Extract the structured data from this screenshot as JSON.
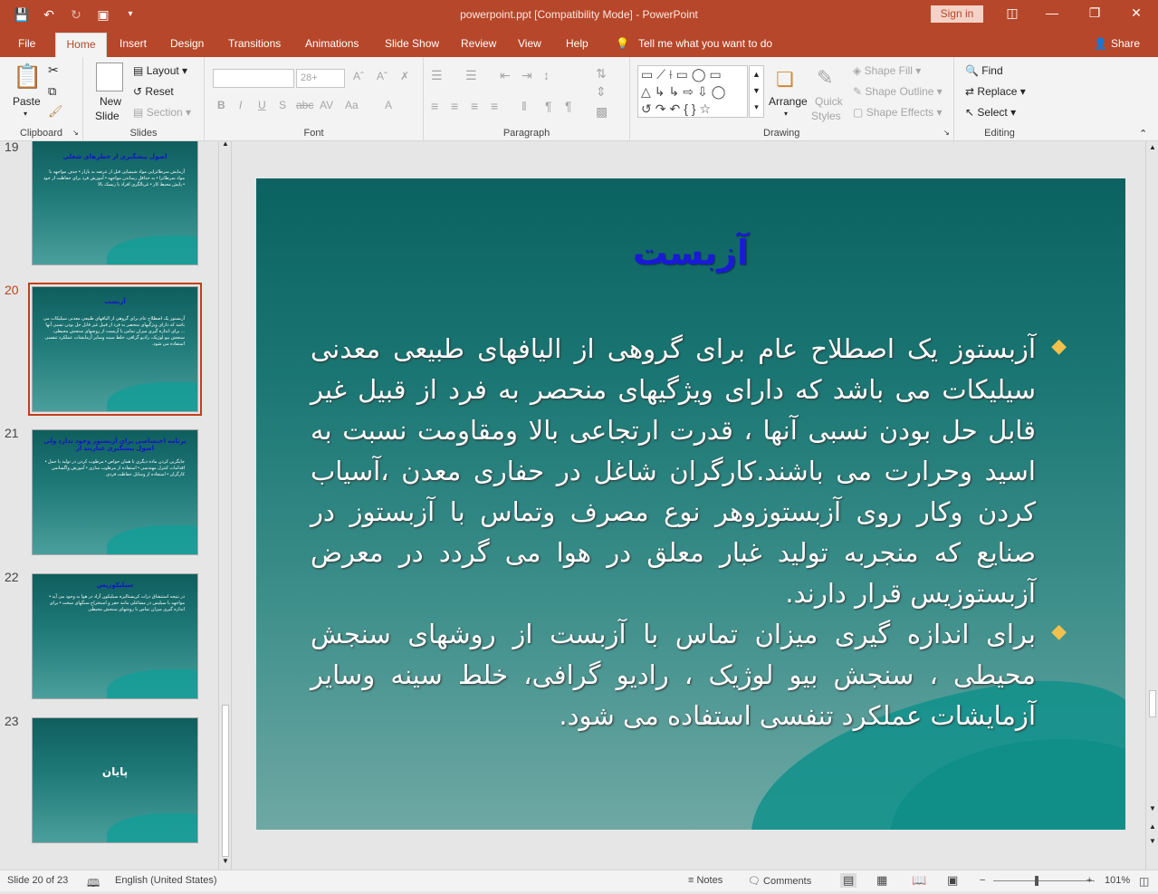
{
  "titlebar": {
    "title": "powerpoint.ppt [Compatibility Mode]  -  PowerPoint",
    "signin": "Sign in",
    "qat": [
      "save-icon",
      "undo-icon",
      "redo-icon",
      "present-icon",
      "customize-icon"
    ]
  },
  "tabs": [
    "File",
    "Home",
    "Insert",
    "Design",
    "Transitions",
    "Animations",
    "Slide Show",
    "Review",
    "View",
    "Help"
  ],
  "active_tab": "Home",
  "tell_me": "Tell me what you want to do",
  "share": "Share",
  "ribbon": {
    "clipboard": {
      "label": "Clipboard",
      "paste": "Paste"
    },
    "slides": {
      "label": "Slides",
      "new_slide_1": "New",
      "new_slide_2": "Slide",
      "layout": "Layout",
      "reset": "Reset",
      "section": "Section"
    },
    "font": {
      "label": "Font",
      "size": "28+"
    },
    "paragraph": {
      "label": "Paragraph"
    },
    "drawing": {
      "label": "Drawing",
      "arrange": "Arrange",
      "quick_styles_1": "Quick",
      "quick_styles_2": "Styles",
      "shape_fill": "Shape Fill",
      "shape_outline": "Shape Outline",
      "shape_effects": "Shape Effects"
    },
    "editing": {
      "label": "Editing",
      "find": "Find",
      "replace": "Replace",
      "select": "Select"
    }
  },
  "thumbnails": [
    {
      "num": "19",
      "title": "اصول پیشگیری از خطرهای شغلی",
      "body": "آزمایش سرطانزایی مواد شیمیایی قبل از عرضه به بازار • حذف مواجهه با مواد سرطانزا • به حداقل رساندن مواجهه • آموزش فرد برای حفاظت از خود • پایش محیط کار • غربالگری افراد با ریسک بالا"
    },
    {
      "num": "20",
      "title": "آزبست",
      "body": "آزبستوز یک اصطلاح عام برای گروهی از الیافهای طبیعی معدنی سیلیکات می باشد که دارای ویژگیهای منحصر به فرد از قبیل غیر قابل حل بودن نسبی آنها ... برای اندازه گیری میزان تماس با آزبست از روشهای سنجش محیطی، سنجش بیو لوژیک، رادیو گرافی، خلط سینه وسایر آزمایشات عملکرد تنفسی استفاده می شود."
    },
    {
      "num": "21",
      "title": "برنامه اختصاصی برای آزبستوز وجود ندارد ولی اصول پیشگیری عبارتند از",
      "body": "جایگزین کردن ماده دیگری با همان خواص • مرطوب کردن در تولید یا حمل • اقدامات کنترل مهندسی • استفاده از مرطوب سازی • آموزش واگسانس کارگران • استفاده از وسایل حفاظت فردی"
    },
    {
      "num": "22",
      "title": "سیلیکوزیس",
      "body": "در نتیجه استنشاق ذرات کریستالیزه سیلیکون آزاد در هوا به وجود می آید • مواجهه با سیلیس در مشاغلی مانند حفر و استخراج سنگهای سخت • برای اندازه گیری میزان تماس با روشهای سنجش محیطی"
    },
    {
      "num": "23",
      "title": "پایان",
      "body": ""
    }
  ],
  "slide": {
    "title": "آزبست",
    "bullets": [
      "آزبستوز یک اصطلاح عام برای گروهی از الیافهای طبیعی معدنی سیلیکات می باشد که دارای ویژگیهای منحصر به فرد از قبیل غیر قابل حل بودن نسبی آنها ، قدرت ارتجاعی بالا ومقاومت نسبت به اسید وحرارت می باشند.کارگران شاغل در حفاری معدن ،آسیاب کردن وکار روی آزبستوزوهر نوع مصرف وتماس با آزبستوز در صنایع که منجربه تولید غبار معلق در هوا می گردد در معرض آزبستوزیس قرار دارند.",
      "برای اندازه گیری میزان تماس با آزبست از روشهای سنجش محیطی ، سنجش بیو لوژیک ، رادیو گرافی، خلط سینه وسایر آزمایشات عملکرد تنفسی استفاده می شود."
    ]
  },
  "status": {
    "slide_info": "Slide 20 of 23",
    "language": "English (United States)",
    "notes": "Notes",
    "comments": "Comments",
    "zoom": "101%"
  }
}
